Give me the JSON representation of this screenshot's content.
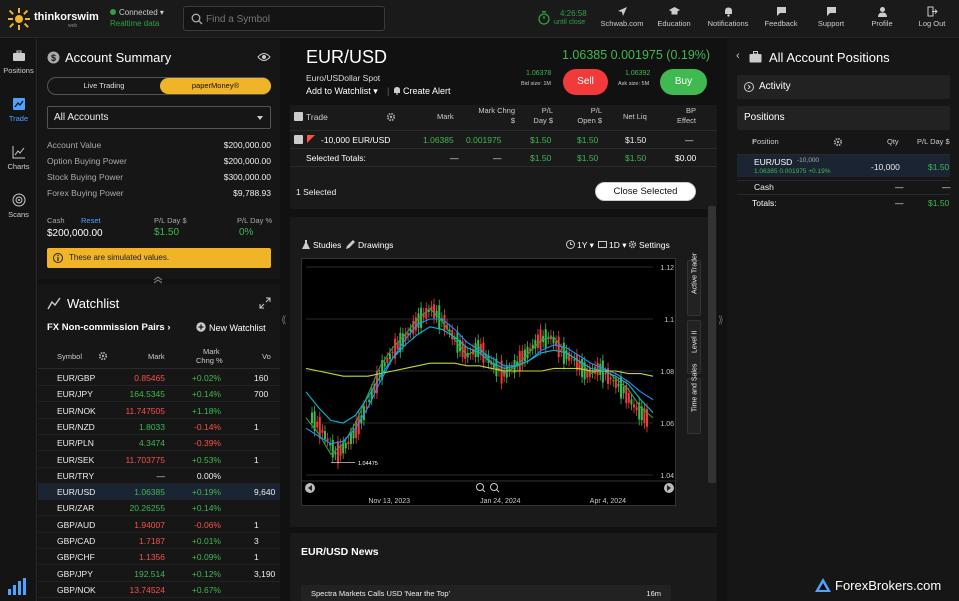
{
  "topbar": {
    "brand": "thinkorswim",
    "brand_sub": "web",
    "connection": {
      "status": "Connected",
      "feed": "Realtime data"
    },
    "search_placeholder": "Find a Symbol",
    "clock": {
      "time": "4:26:58",
      "label": "until close"
    },
    "nav": [
      {
        "label": "Schwab.com",
        "icon": "send-icon"
      },
      {
        "label": "Education",
        "icon": "education-icon"
      },
      {
        "label": "Notifications",
        "icon": "bell-icon"
      },
      {
        "label": "Feedback",
        "icon": "feedback-icon"
      },
      {
        "label": "Support",
        "icon": "support-icon"
      },
      {
        "label": "Profile",
        "icon": "profile-icon"
      },
      {
        "label": "Log Out",
        "icon": "logout-icon"
      }
    ]
  },
  "leftnav": [
    {
      "label": "Positions",
      "icon": "briefcase-icon"
    },
    {
      "label": "Trade",
      "icon": "trade-icon"
    },
    {
      "label": "Charts",
      "icon": "charts-icon"
    },
    {
      "label": "Scans",
      "icon": "scans-icon"
    }
  ],
  "account": {
    "title": "Account Summary",
    "mode_live": "Live Trading",
    "mode_paper": "paperMoney®",
    "account_select": "All Accounts",
    "rows": [
      {
        "label": "Account Value",
        "value": "$200,000.00"
      },
      {
        "label": "Option Buying Power",
        "value": "$200,000.00"
      },
      {
        "label": "Stock Buying Power",
        "value": "$300,000.00"
      },
      {
        "label": "Forex Buying Power",
        "value": "$9,788.93"
      }
    ],
    "cash_label": "Cash",
    "reset_label": "Reset",
    "cash_value": "$200,000.00",
    "pl_day_label": "P/L Day $",
    "pl_day_value": "$1.50",
    "pl_day_pct_label": "P/L Day %",
    "pl_day_pct_value": "0%",
    "notice": "These are simulated values."
  },
  "watchlist": {
    "title": "Watchlist",
    "list_name": "FX Non-commission Pairs",
    "new_label": "New Watchlist",
    "columns": {
      "symbol": "Symbol",
      "mark": "Mark",
      "chng1": "Mark",
      "chng2": "Chng %",
      "vol": "Vo"
    },
    "rows": [
      {
        "symbol": "EUR/GBP",
        "mark": "0.85465",
        "chng": "+0.02%",
        "vol": "160",
        "dir": "down"
      },
      {
        "symbol": "EUR/JPY",
        "mark": "164.5345",
        "chng": "+0.14%",
        "vol": "700",
        "dir": "up"
      },
      {
        "symbol": "EUR/NOK",
        "mark": "11.747505",
        "chng": "+1.18%",
        "vol": "",
        "dir": "down"
      },
      {
        "symbol": "EUR/NZD",
        "mark": "1.8033",
        "chng": "-0.14%",
        "vol": "1",
        "dir": "up"
      },
      {
        "symbol": "EUR/PLN",
        "mark": "4.3474",
        "chng": "-0.39%",
        "vol": "",
        "dir": "up"
      },
      {
        "symbol": "EUR/SEK",
        "mark": "11.703775",
        "chng": "+0.53%",
        "vol": "1",
        "dir": "down"
      },
      {
        "symbol": "EUR/TRY",
        "mark": "—",
        "chng": "0.00%",
        "vol": "",
        "dir": "flat"
      },
      {
        "symbol": "EUR/USD",
        "mark": "1.06385",
        "chng": "+0.19%",
        "vol": "9,640",
        "dir": "up"
      },
      {
        "symbol": "EUR/ZAR",
        "mark": "20.26255",
        "chng": "+0.14%",
        "vol": "",
        "dir": "up"
      },
      {
        "symbol": "GBP/AUD",
        "mark": "1.94007",
        "chng": "-0.06%",
        "vol": "1",
        "dir": "down"
      },
      {
        "symbol": "GBP/CAD",
        "mark": "1.7187",
        "chng": "+0.01%",
        "vol": "3",
        "dir": "down"
      },
      {
        "symbol": "GBP/CHF",
        "mark": "1.1356",
        "chng": "+0.09%",
        "vol": "1",
        "dir": "down"
      },
      {
        "symbol": "GBP/JPY",
        "mark": "192.514",
        "chng": "+0.12%",
        "vol": "3,190",
        "dir": "up"
      },
      {
        "symbol": "GBP/NOK",
        "mark": "13.74524",
        "chng": "+0.67%",
        "vol": "",
        "dir": "down"
      }
    ]
  },
  "quote": {
    "symbol": "EUR/USD",
    "description": "Euro/USDollar Spot",
    "price": "1.06385",
    "change": "0.001975",
    "change_pct": "(0.19%)",
    "bid": "1.06378",
    "bid_size": "Bid size: 1M",
    "ask": "1.06392",
    "ask_size": "Ask size: 5M",
    "sell": "Sell",
    "buy": "Buy",
    "add_watch": "Add to Watchlist",
    "create_alert": "Create Alert"
  },
  "positions_table": {
    "headers": [
      "Trade",
      "Mark",
      "Mark Chng $",
      "P/L Day $",
      "P/L Open $",
      "Net Liq",
      "BP Effect"
    ],
    "row": [
      "-10,000 EUR/USD",
      "1.06385",
      "0.001975",
      "$1.50",
      "$1.50",
      "$1.50",
      "—"
    ],
    "totals": [
      "Selected Totals:",
      "—",
      "—",
      "$1.50",
      "$1.50",
      "$1.50",
      "$0.00"
    ],
    "selected": "1 Selected",
    "close_btn": "Close Selected"
  },
  "chart": {
    "studies": "Studies",
    "drawings": "Drawings",
    "range": "1Y",
    "interval": "1D",
    "settings": "Settings",
    "side_tabs": [
      "Active Trader",
      "Level II",
      "Time and Sales"
    ],
    "low_label": "1.04475"
  },
  "chart_data": {
    "type": "line",
    "title": "",
    "xlabel": "",
    "ylabel": "",
    "ylim": [
      1.04,
      1.12
    ],
    "y_ticks": [
      "1.12",
      "1.1",
      "1.08",
      "1.06",
      "1.04"
    ],
    "x_ticks": [
      "Nov 13, 2023",
      "Jan 24, 2024",
      "Apr 4, 2024"
    ],
    "series": [
      {
        "color": "#2ea043",
        "values": [
          1.062,
          1.056,
          1.048,
          1.052,
          1.06,
          1.071,
          1.082,
          1.089,
          1.094,
          1.1,
          1.104,
          1.099,
          1.092,
          1.086,
          1.089,
          1.083,
          1.079,
          1.082,
          1.087,
          1.092,
          1.093,
          1.087,
          1.084,
          1.079,
          1.081,
          1.077,
          1.073,
          1.066,
          1.062
        ]
      },
      {
        "color": "#1e90ff",
        "values": [
          1.058,
          1.055,
          1.052,
          1.053,
          1.058,
          1.066,
          1.076,
          1.085,
          1.092,
          1.098,
          1.1,
          1.1,
          1.096,
          1.091,
          1.088,
          1.085,
          1.082,
          1.082,
          1.084,
          1.088,
          1.09,
          1.089,
          1.086,
          1.083,
          1.081,
          1.079,
          1.076,
          1.072,
          1.069
        ]
      },
      {
        "color": "#c8d23a",
        "values": [
          1.081,
          1.08,
          1.079,
          1.078,
          1.078,
          1.078,
          1.079,
          1.08,
          1.081,
          1.082,
          1.083,
          1.083,
          1.083,
          1.082,
          1.082,
          1.081,
          1.08,
          1.08,
          1.08,
          1.08,
          1.081,
          1.081,
          1.081,
          1.08,
          1.08,
          1.08,
          1.079,
          1.079,
          1.078
        ]
      },
      {
        "color": "#00bcd4",
        "values": [
          1.072,
          1.066,
          1.061,
          1.06,
          1.063,
          1.07,
          1.078,
          1.085,
          1.09,
          1.094,
          1.097,
          1.096,
          1.093,
          1.089,
          1.087,
          1.083,
          1.081,
          1.082,
          1.084,
          1.087,
          1.088,
          1.087,
          1.084,
          1.081,
          1.08,
          1.078,
          1.075,
          1.069,
          1.064
        ]
      }
    ]
  },
  "news": {
    "title": "EUR/USD News",
    "items": [
      {
        "headline": "Spectra Markets Calls USD 'Near the Top'",
        "age": "16m"
      }
    ]
  },
  "right_panel": {
    "title": "All Account Positions",
    "activity": "Activity",
    "positions": "Positions",
    "headers": [
      "Position",
      "Qty",
      "P/L Day $"
    ],
    "row": {
      "symbol": "EUR/USD",
      "qty_note": "-10,000",
      "price": "1.06385",
      "chg": "0.001975",
      "pct": "+0.19%",
      "qty": "-10,000",
      "pl": "$1.50"
    },
    "cash_label": "Cash",
    "cash_qty": "—",
    "cash_pl": "—",
    "totals_label": "Totals:",
    "totals_qty": "—",
    "totals_pl": "$1.50"
  },
  "footer": {
    "brand": "ForexBrokers.com"
  }
}
